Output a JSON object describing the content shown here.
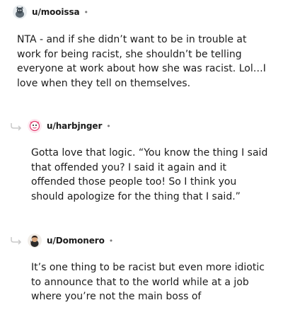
{
  "comments": [
    {
      "username": "u/mooissa",
      "separator": "•",
      "avatar": "avatar-icon",
      "text": "NTA - and if she didn’t want to be in trouble at work for being racist, she shouldn’t be telling everyone at work about how she was racist. Lol…I love when they tell on themselves."
    },
    {
      "username": "u/harbjnger",
      "separator": "•",
      "avatar": "avatar-icon",
      "text": "Gotta love that logic. “You know the thing I said that offended you? I said it again and it offended those people too! So I think you should apologize for the thing that I said.”"
    },
    {
      "username": "u/Domonero",
      "separator": "•",
      "avatar": "avatar-icon",
      "text": "It’s one thing to be racist but even more idiotic to announce that to the world while at a job where you’re not the main boss of"
    }
  ],
  "icons": {
    "reply_indicator": "reply-arrow-icon"
  },
  "colors": {
    "text": "#1c1c1c",
    "meta": "#7c7c7c",
    "thread_line": "#c8c8c8"
  }
}
